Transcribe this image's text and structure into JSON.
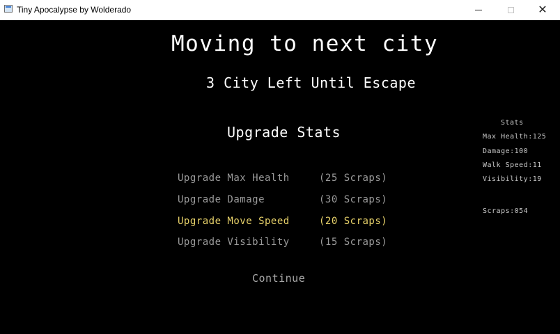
{
  "window": {
    "title": "Tiny Apocalypse by Wolderado",
    "controls": {
      "minimize": "—",
      "maximize": "☐",
      "close": "✕"
    }
  },
  "game": {
    "heading": "Moving to next city",
    "subheading": "3 City Left Until Escape",
    "upgrade_title": "Upgrade Stats",
    "upgrades": [
      {
        "label": "Upgrade Max Health",
        "cost": "(25 Scraps)",
        "selected": false
      },
      {
        "label": "Upgrade Damage",
        "cost": "(30 Scraps)",
        "selected": false
      },
      {
        "label": "Upgrade Move Speed",
        "cost": "(20 Scraps)",
        "selected": true
      },
      {
        "label": "Upgrade Visibility",
        "cost": "(15 Scraps)",
        "selected": false
      }
    ],
    "continue_label": "Continue",
    "colors": {
      "selected": "#e8d26a",
      "unselected": "#9a9a9a",
      "background": "#000000"
    }
  },
  "stats": {
    "title": "Stats",
    "max_health": "Max Health:125",
    "damage": "Damage:100",
    "walk_speed": "Walk Speed:11",
    "visibility": "Visibility:19",
    "scraps": "Scraps:054"
  }
}
